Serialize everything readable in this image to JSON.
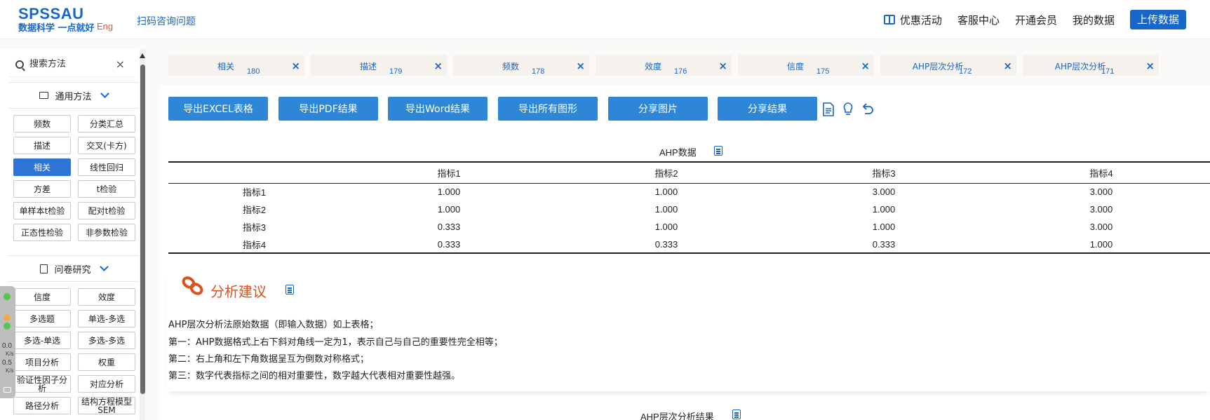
{
  "header": {
    "logo_main": "SPSSAU",
    "logo_sub": "数据科学 一点就好",
    "logo_eng": "Eng",
    "scan_link": "扫码咨询问题",
    "nav": [
      "优惠活动",
      "客服中心",
      "开通会员",
      "我的数据"
    ],
    "upload": "上传数据"
  },
  "sidebar": {
    "search_placeholder": "搜索方法",
    "search_clear": "×",
    "section1": "通用方法",
    "section1_items": [
      "频数",
      "分类汇总",
      "描述",
      "交叉(卡方)",
      "相关",
      "线性回归",
      "方差",
      "t检验",
      "单样本t检验",
      "配对t检验",
      "正态性检验",
      "非参数检验"
    ],
    "active_item": "相关",
    "section2": "问卷研究",
    "section2_items": [
      "信度",
      "效度",
      "多选题",
      "单选-多选",
      "多选-单选",
      "多选-多选",
      "项目分析",
      "权重",
      "验证性因子分析",
      "对应分析",
      "路径分析",
      "结构方程模型SEM"
    ]
  },
  "speed": {
    "down": "0.0",
    "up": "0.5",
    "unit": "K/s"
  },
  "tabs": [
    {
      "label": "相关",
      "num": "180"
    },
    {
      "label": "描述",
      "num": "179"
    },
    {
      "label": "频数",
      "num": "178"
    },
    {
      "label": "效度",
      "num": "176"
    },
    {
      "label": "信度",
      "num": "175"
    },
    {
      "label": "AHP层次分析",
      "num": "172"
    },
    {
      "label": "AHP层次分析",
      "num": "171"
    }
  ],
  "tab_close": "×",
  "actions": [
    "导出EXCEL表格",
    "导出PDF结果",
    "导出Word结果",
    "导出所有图形",
    "分享图片",
    "分享结果"
  ],
  "table": {
    "title": "AHP数据",
    "headers": [
      "",
      "指标1",
      "指标2",
      "指标3",
      "指标4"
    ],
    "rows": [
      [
        "指标1",
        "1.000",
        "1.000",
        "3.000",
        "3.000"
      ],
      [
        "指标2",
        "1.000",
        "1.000",
        "1.000",
        "3.000"
      ],
      [
        "指标3",
        "0.333",
        "1.000",
        "1.000",
        "3.000"
      ],
      [
        "指标4",
        "0.333",
        "0.333",
        "0.333",
        "1.000"
      ]
    ]
  },
  "advice": {
    "title": "分析建议",
    "lines": [
      "AHP层次分析法原始数据（即输入数据）如上表格；",
      "第一：AHP数据格式上右下斜对角线一定为1，表示自己与自己的重要性完全相等；",
      "第二：右上角和左下角数据呈互为倒数对称格式；",
      "第三：数字代表指标之间的相对重要性，数字越大代表相对重要性越强。"
    ]
  },
  "bottom_title": "AHP层次分析结果",
  "colors": {
    "brand": "#1766c8",
    "button": "#2d87d6",
    "accent": "#d9531e"
  }
}
